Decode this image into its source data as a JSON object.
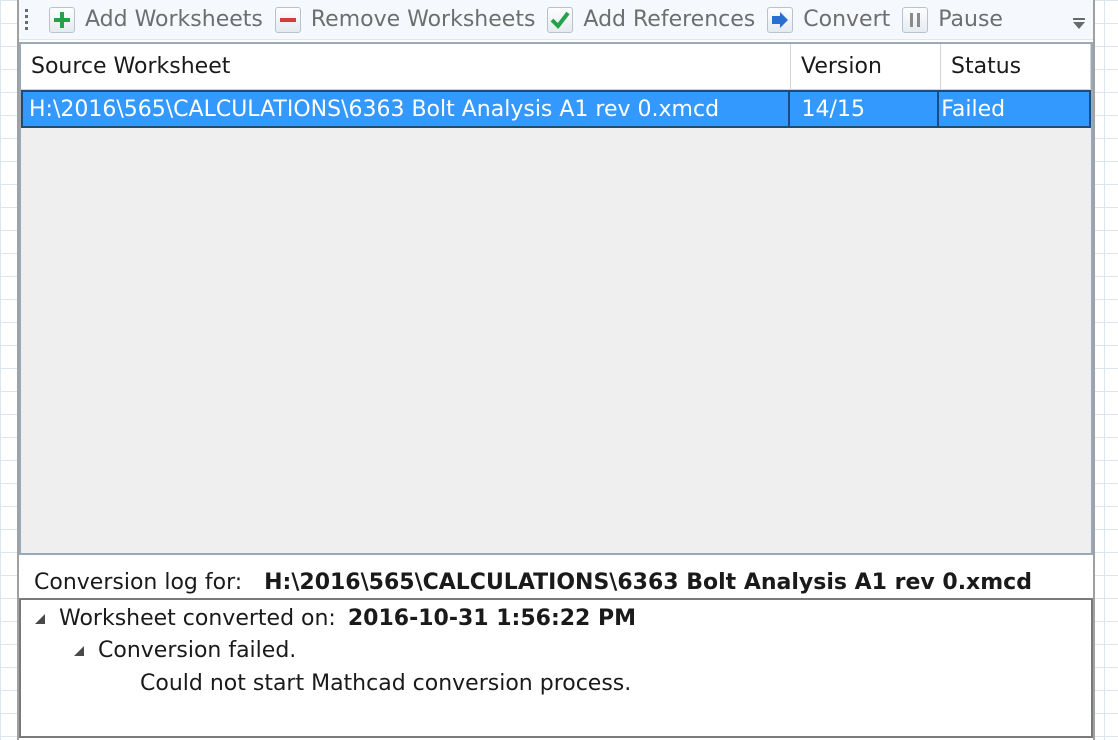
{
  "toolbar": {
    "add_worksheets": "Add Worksheets",
    "remove_worksheets": "Remove Worksheets",
    "add_references": "Add References",
    "convert": "Convert",
    "pause": "Pause"
  },
  "grid": {
    "columns": [
      "Source Worksheet",
      "Version",
      "Status"
    ],
    "rows": [
      {
        "source": "H:\\2016\\565\\CALCULATIONS\\6363 Bolt Analysis A1 rev 0.xmcd",
        "version": "14/15",
        "status": "Failed"
      }
    ]
  },
  "log": {
    "header_label": "Conversion log for:",
    "header_path": "H:\\2016\\565\\CALCULATIONS\\6363 Bolt Analysis A1 rev 0.xmcd",
    "converted_on_label": "Worksheet converted on:",
    "converted_on_value": "2016-10-31 1:56:22 PM",
    "failed": "Conversion failed.",
    "detail": "Could not start Mathcad conversion process."
  },
  "colors": {
    "selection": "#3399ff",
    "selection_border": "#1e4b78",
    "add_green": "#22a34a",
    "remove_red": "#d63a3a",
    "convert_blue": "#2a6fcf"
  },
  "icons": [
    "plus-icon",
    "minus-icon",
    "checkmark-icon",
    "convert-arrow-icon",
    "pause-icon",
    "overflow-chevron-icon",
    "collapse-triangle-icon"
  ]
}
